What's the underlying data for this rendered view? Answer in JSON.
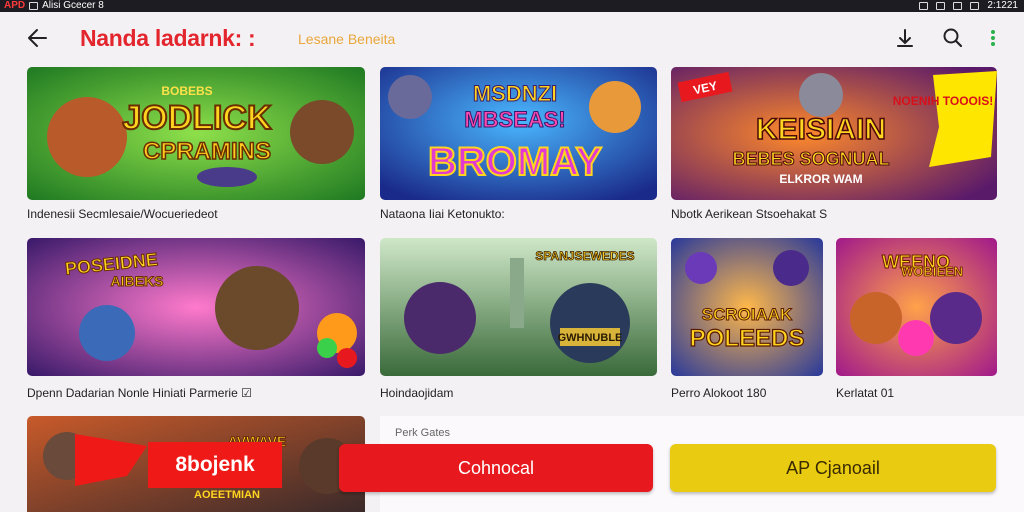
{
  "status_bar": {
    "app_label": "APD",
    "left_text": "Alisi Gcecer 8",
    "time": "2:1221"
  },
  "toolbar": {
    "title": "Nanda ladarnk: :",
    "subtitle": "Lesane Beneita"
  },
  "icons": {
    "back": "back-arrow-icon",
    "download": "download-icon",
    "search": "search-icon",
    "more": "more-vert-icon"
  },
  "games": [
    {
      "caption": "Indenesii Secmlesaie/Wocueriedeot",
      "art_line1": "JODLICK",
      "art_line2": "CPRAMINS",
      "art_top": "BOBEBS"
    },
    {
      "caption": "Nataona Iiai Ketonukto:",
      "art_line1": "MSDNZI",
      "art_line2": "MBSEAS!",
      "art_line3": "BROMAY"
    },
    {
      "caption": "Nbotk Aerikean Stsoehakat S",
      "art_line1": "KEISIAIN",
      "art_line2": "BEBES SOGNUAL",
      "art_line3": "ELKROR WAM",
      "art_badge": "NOENIH TOOOIS! WODI",
      "art_flag": "VEY"
    },
    {
      "caption": "Dpenn Dadarian Nonle Hiniati Parmerie ☑",
      "art_line1": "POSEIDNE",
      "art_line2": "AIBEKS"
    },
    {
      "caption": "Hoindaojidam",
      "art_line1": "SPANJSEWEDES"
    },
    {
      "caption": "Perro Alokoot 180",
      "art_line1": "SCROIAAK",
      "art_line2": "POLEEDS"
    },
    {
      "caption": "Kerlatat 01",
      "art_line1": "WEENO",
      "art_line2": "WOBIEEN"
    },
    {
      "caption": "",
      "art_top": "AVWAVE",
      "art_bottom": "AOEETMIAN"
    }
  ],
  "promo": {
    "tag": "8bojenk"
  },
  "panel": {
    "label": "Perk Gates",
    "connect_label": "Cohnocal",
    "ap_label": "AP Cjanoail"
  },
  "colors": {
    "title": "#e3262e",
    "subtitle": "#e9a73c",
    "connect": "#e8191e",
    "ap": "#e9cc12",
    "more": "#2bb04a"
  }
}
